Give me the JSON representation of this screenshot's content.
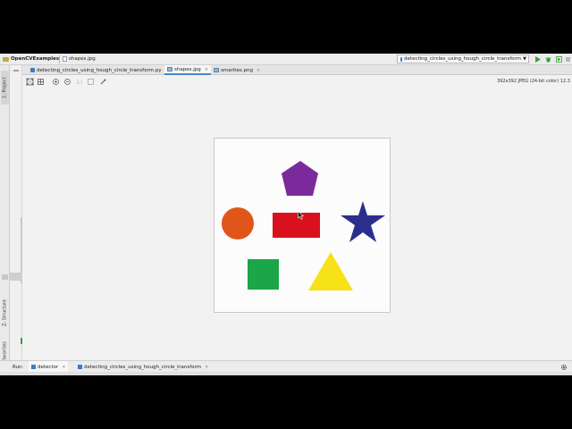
{
  "navbar": {
    "project": "OpenCVExamples",
    "file": "shapes.jpg",
    "run_config": "detecting_circles_using_hough_circle_transform"
  },
  "left_strip": {
    "project_tab": "1: Project",
    "structure_tab": "Z: Structure",
    "favorites_tab": "2: Favorites"
  },
  "tabs": [
    {
      "label": "detecting_circles_using_hough_circle_transform.py",
      "kind": "python"
    },
    {
      "label": "shapes.jpg",
      "kind": "image",
      "active": true
    },
    {
      "label": "smarties.png",
      "kind": "image"
    }
  ],
  "viewer": {
    "image_info": "392x392 JPEG (24-bit color) 12.3"
  },
  "image": {
    "shapes": [
      {
        "shape": "pentagon",
        "color": "#7b2a9b"
      },
      {
        "shape": "circle",
        "color": "#e0561a"
      },
      {
        "shape": "rectangle",
        "color": "#d9101e"
      },
      {
        "shape": "star",
        "color": "#2b2e8c"
      },
      {
        "shape": "square",
        "color": "#1aa649"
      },
      {
        "shape": "triangle",
        "color": "#f7e21a"
      }
    ]
  },
  "bottom": {
    "run_label": "Run:",
    "tabs": [
      {
        "label": "detector",
        "active": true
      },
      {
        "label": "detecting_circles_using_hough_circle_transform"
      }
    ]
  },
  "colors": {
    "accent": "#4a88c7",
    "run_green": "#3aa03a"
  }
}
